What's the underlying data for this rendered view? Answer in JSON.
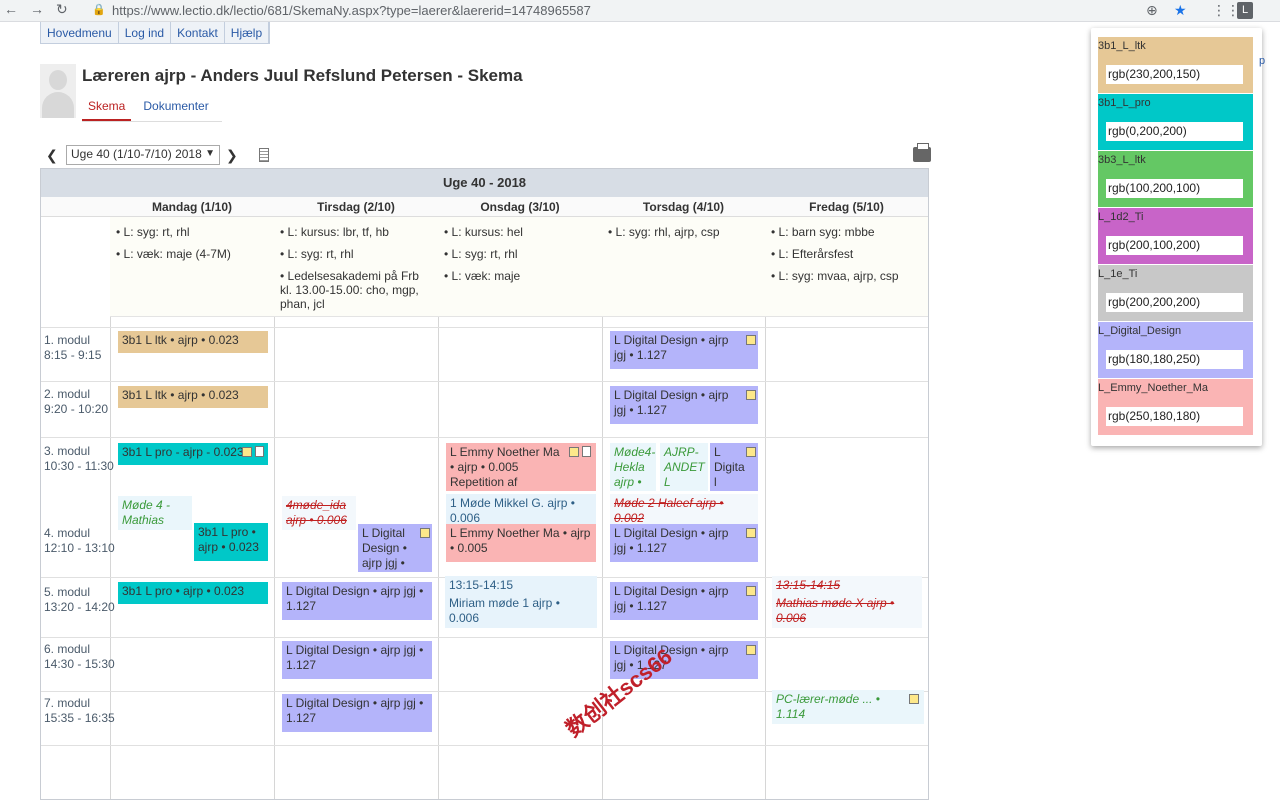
{
  "browser": {
    "url": "https://www.lectio.dk/lectio/681/SkemaNy.aspx?type=laerer&laererid=14748965587",
    "extension_letter": "L"
  },
  "menu": [
    "Hovedmenu",
    "Log ind",
    "Kontakt",
    "Hjælp"
  ],
  "page": {
    "title": "Læreren ajrp - Anders Juul Refslund Petersen - Skema",
    "tabs": [
      "Skema",
      "Dokumenter"
    ],
    "week_select": "Uge 40 (1/10-7/10) 2018"
  },
  "schedule": {
    "week_title": "Uge 40 - 2018",
    "days": [
      "Mandag (1/10)",
      "Tirsdag (2/10)",
      "Onsdag (3/10)",
      "Torsdag (4/10)",
      "Fredag (5/10)"
    ],
    "notes": [
      [
        "• L: syg: rt, rhl",
        "• L: væk: maje (4-7M)"
      ],
      [
        "• L: kursus: lbr, tf, hb",
        "• L: syg: rt, rhl",
        "• Ledelsesakademi på Frb kl. 13.00-15.00: cho, mgp, phan, jcl"
      ],
      [
        "• L: kursus: hel",
        "• L: syg: rt, rhl",
        "• L: væk: maje"
      ],
      [
        "• L: syg: rhl, ajrp, csp"
      ],
      [
        "• L: barn syg: mbbe",
        "• L: Efterårsfest",
        "• L: syg: mvaa, ajrp, csp"
      ]
    ],
    "modules": [
      {
        "name": "1. modul",
        "time": "8:15 - 9:15"
      },
      {
        "name": "2. modul",
        "time": "9:20 - 10:20"
      },
      {
        "name": "3. modul",
        "time": "10:30 - 11:30"
      },
      {
        "name": "4. modul",
        "time": "12:10 - 13:10"
      },
      {
        "name": "5. modul",
        "time": "13:20 - 14:20"
      },
      {
        "name": "6. modul",
        "time": "14:30 - 15:30"
      },
      {
        "name": "7. modul",
        "time": "15:35 - 16:35"
      }
    ],
    "lessons": {
      "mon1": "3b1 L ltk • ajrp • 0.023",
      "mon2": "3b1 L ltk • ajrp • 0.023",
      "mon3": "3b1 L pro - ajrp - 0.023",
      "mon_meet": "Møde 4 - Mathias",
      "mon4": "3b1 L pro • ajrp • 0.023",
      "mon5": "3b1 L pro • ajrp • 0.023",
      "tue_cancel": "4møde_ida ajrp • 0.006",
      "tue4": "L Digital Design • ajrp jgj •",
      "tue5": "L Digital Design • ajrp jgj • 1.127",
      "tue6": "L Digital Design • ajrp jgj • 1.127",
      "tue7": "L Digital Design • ajrp jgj • 1.127",
      "wed3": "L Emmy Noether Ma • ajrp • 0.005 Repetition af",
      "wed_meet": "1 Møde Mikkel G. ajrp • 0.006",
      "wed4": "L Emmy Noether Ma • ajrp • 0.005",
      "wed5_time": "13:15-14:15",
      "wed5": "Miriam møde 1 ajrp • 0.006",
      "thu1": "L Digital Design • ajrp jgj • 1.127",
      "thu2": "L Digital Design • ajrp jgj • 1.127",
      "thu3a": "Møde4-Hekla ajrp •",
      "thu3b": "AJRP-ANDET L Digital",
      "thu3c": "L Digita l Design",
      "thu_cancel": "Møde 2 Haleef ajrp • 0.002",
      "thu4": "L Digital Design • ajrp jgj • 1.127",
      "thu5": "L Digital Design • ajrp jgj • 1.127",
      "thu6": "L Digital Design • ajrp jgj • 1.127",
      "fri5_time": "13:15-14:15",
      "fri5": "Mathias møde X ajrp • 0.006",
      "fri7": "PC-lærer-møde ... • 1.114"
    }
  },
  "legend": [
    {
      "label": "3b1_L_ltk",
      "value": "rgb(230,200,150)",
      "color": "#e6c896"
    },
    {
      "label": "3b1_L_pro",
      "value": "rgb(0,200,200)",
      "color": "#00c8c8"
    },
    {
      "label": "3b3_L_ltk",
      "value": "rgb(100,200,100)",
      "color": "#64c864"
    },
    {
      "label": "L_1d2_Ti",
      "value": "rgb(200,100,200)",
      "color": "#c864c8"
    },
    {
      "label": "L_1e_Ti",
      "value": "rgb(200,200,200)",
      "color": "#c8c8c8"
    },
    {
      "label": "L_Digital_Design",
      "value": "rgb(180,180,250)",
      "color": "#b4b4fa"
    },
    {
      "label": "L_Emmy_Noether_Ma",
      "value": "rgb(250,180,180)",
      "color": "#fab4b4"
    }
  ],
  "edge_text": "p",
  "watermark": "数创社scs66"
}
